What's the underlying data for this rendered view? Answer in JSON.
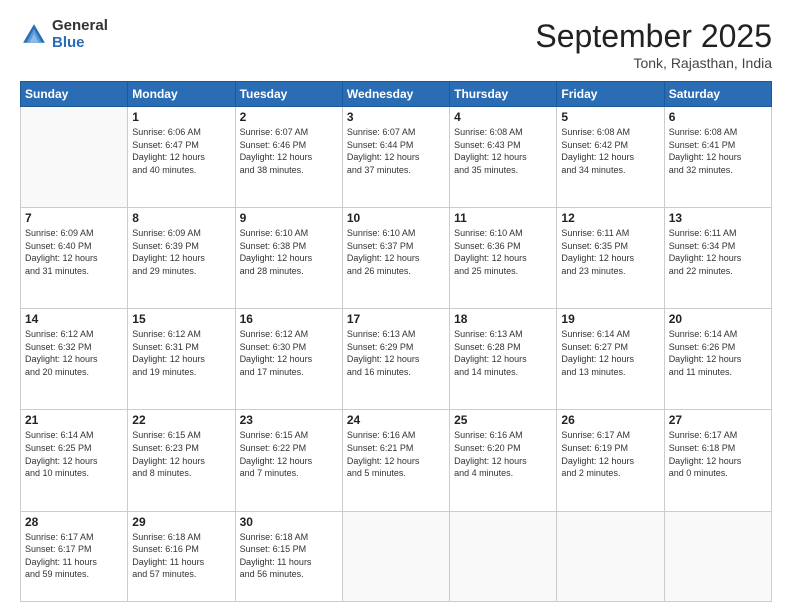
{
  "logo": {
    "general": "General",
    "blue": "Blue"
  },
  "header": {
    "month": "September 2025",
    "location": "Tonk, Rajasthan, India"
  },
  "days_of_week": [
    "Sunday",
    "Monday",
    "Tuesday",
    "Wednesday",
    "Thursday",
    "Friday",
    "Saturday"
  ],
  "weeks": [
    [
      {
        "day": "",
        "info": ""
      },
      {
        "day": "1",
        "info": "Sunrise: 6:06 AM\nSunset: 6:47 PM\nDaylight: 12 hours\nand 40 minutes."
      },
      {
        "day": "2",
        "info": "Sunrise: 6:07 AM\nSunset: 6:46 PM\nDaylight: 12 hours\nand 38 minutes."
      },
      {
        "day": "3",
        "info": "Sunrise: 6:07 AM\nSunset: 6:44 PM\nDaylight: 12 hours\nand 37 minutes."
      },
      {
        "day": "4",
        "info": "Sunrise: 6:08 AM\nSunset: 6:43 PM\nDaylight: 12 hours\nand 35 minutes."
      },
      {
        "day": "5",
        "info": "Sunrise: 6:08 AM\nSunset: 6:42 PM\nDaylight: 12 hours\nand 34 minutes."
      },
      {
        "day": "6",
        "info": "Sunrise: 6:08 AM\nSunset: 6:41 PM\nDaylight: 12 hours\nand 32 minutes."
      }
    ],
    [
      {
        "day": "7",
        "info": "Sunrise: 6:09 AM\nSunset: 6:40 PM\nDaylight: 12 hours\nand 31 minutes."
      },
      {
        "day": "8",
        "info": "Sunrise: 6:09 AM\nSunset: 6:39 PM\nDaylight: 12 hours\nand 29 minutes."
      },
      {
        "day": "9",
        "info": "Sunrise: 6:10 AM\nSunset: 6:38 PM\nDaylight: 12 hours\nand 28 minutes."
      },
      {
        "day": "10",
        "info": "Sunrise: 6:10 AM\nSunset: 6:37 PM\nDaylight: 12 hours\nand 26 minutes."
      },
      {
        "day": "11",
        "info": "Sunrise: 6:10 AM\nSunset: 6:36 PM\nDaylight: 12 hours\nand 25 minutes."
      },
      {
        "day": "12",
        "info": "Sunrise: 6:11 AM\nSunset: 6:35 PM\nDaylight: 12 hours\nand 23 minutes."
      },
      {
        "day": "13",
        "info": "Sunrise: 6:11 AM\nSunset: 6:34 PM\nDaylight: 12 hours\nand 22 minutes."
      }
    ],
    [
      {
        "day": "14",
        "info": "Sunrise: 6:12 AM\nSunset: 6:32 PM\nDaylight: 12 hours\nand 20 minutes."
      },
      {
        "day": "15",
        "info": "Sunrise: 6:12 AM\nSunset: 6:31 PM\nDaylight: 12 hours\nand 19 minutes."
      },
      {
        "day": "16",
        "info": "Sunrise: 6:12 AM\nSunset: 6:30 PM\nDaylight: 12 hours\nand 17 minutes."
      },
      {
        "day": "17",
        "info": "Sunrise: 6:13 AM\nSunset: 6:29 PM\nDaylight: 12 hours\nand 16 minutes."
      },
      {
        "day": "18",
        "info": "Sunrise: 6:13 AM\nSunset: 6:28 PM\nDaylight: 12 hours\nand 14 minutes."
      },
      {
        "day": "19",
        "info": "Sunrise: 6:14 AM\nSunset: 6:27 PM\nDaylight: 12 hours\nand 13 minutes."
      },
      {
        "day": "20",
        "info": "Sunrise: 6:14 AM\nSunset: 6:26 PM\nDaylight: 12 hours\nand 11 minutes."
      }
    ],
    [
      {
        "day": "21",
        "info": "Sunrise: 6:14 AM\nSunset: 6:25 PM\nDaylight: 12 hours\nand 10 minutes."
      },
      {
        "day": "22",
        "info": "Sunrise: 6:15 AM\nSunset: 6:23 PM\nDaylight: 12 hours\nand 8 minutes."
      },
      {
        "day": "23",
        "info": "Sunrise: 6:15 AM\nSunset: 6:22 PM\nDaylight: 12 hours\nand 7 minutes."
      },
      {
        "day": "24",
        "info": "Sunrise: 6:16 AM\nSunset: 6:21 PM\nDaylight: 12 hours\nand 5 minutes."
      },
      {
        "day": "25",
        "info": "Sunrise: 6:16 AM\nSunset: 6:20 PM\nDaylight: 12 hours\nand 4 minutes."
      },
      {
        "day": "26",
        "info": "Sunrise: 6:17 AM\nSunset: 6:19 PM\nDaylight: 12 hours\nand 2 minutes."
      },
      {
        "day": "27",
        "info": "Sunrise: 6:17 AM\nSunset: 6:18 PM\nDaylight: 12 hours\nand 0 minutes."
      }
    ],
    [
      {
        "day": "28",
        "info": "Sunrise: 6:17 AM\nSunset: 6:17 PM\nDaylight: 11 hours\nand 59 minutes."
      },
      {
        "day": "29",
        "info": "Sunrise: 6:18 AM\nSunset: 6:16 PM\nDaylight: 11 hours\nand 57 minutes."
      },
      {
        "day": "30",
        "info": "Sunrise: 6:18 AM\nSunset: 6:15 PM\nDaylight: 11 hours\nand 56 minutes."
      },
      {
        "day": "",
        "info": ""
      },
      {
        "day": "",
        "info": ""
      },
      {
        "day": "",
        "info": ""
      },
      {
        "day": "",
        "info": ""
      }
    ]
  ]
}
